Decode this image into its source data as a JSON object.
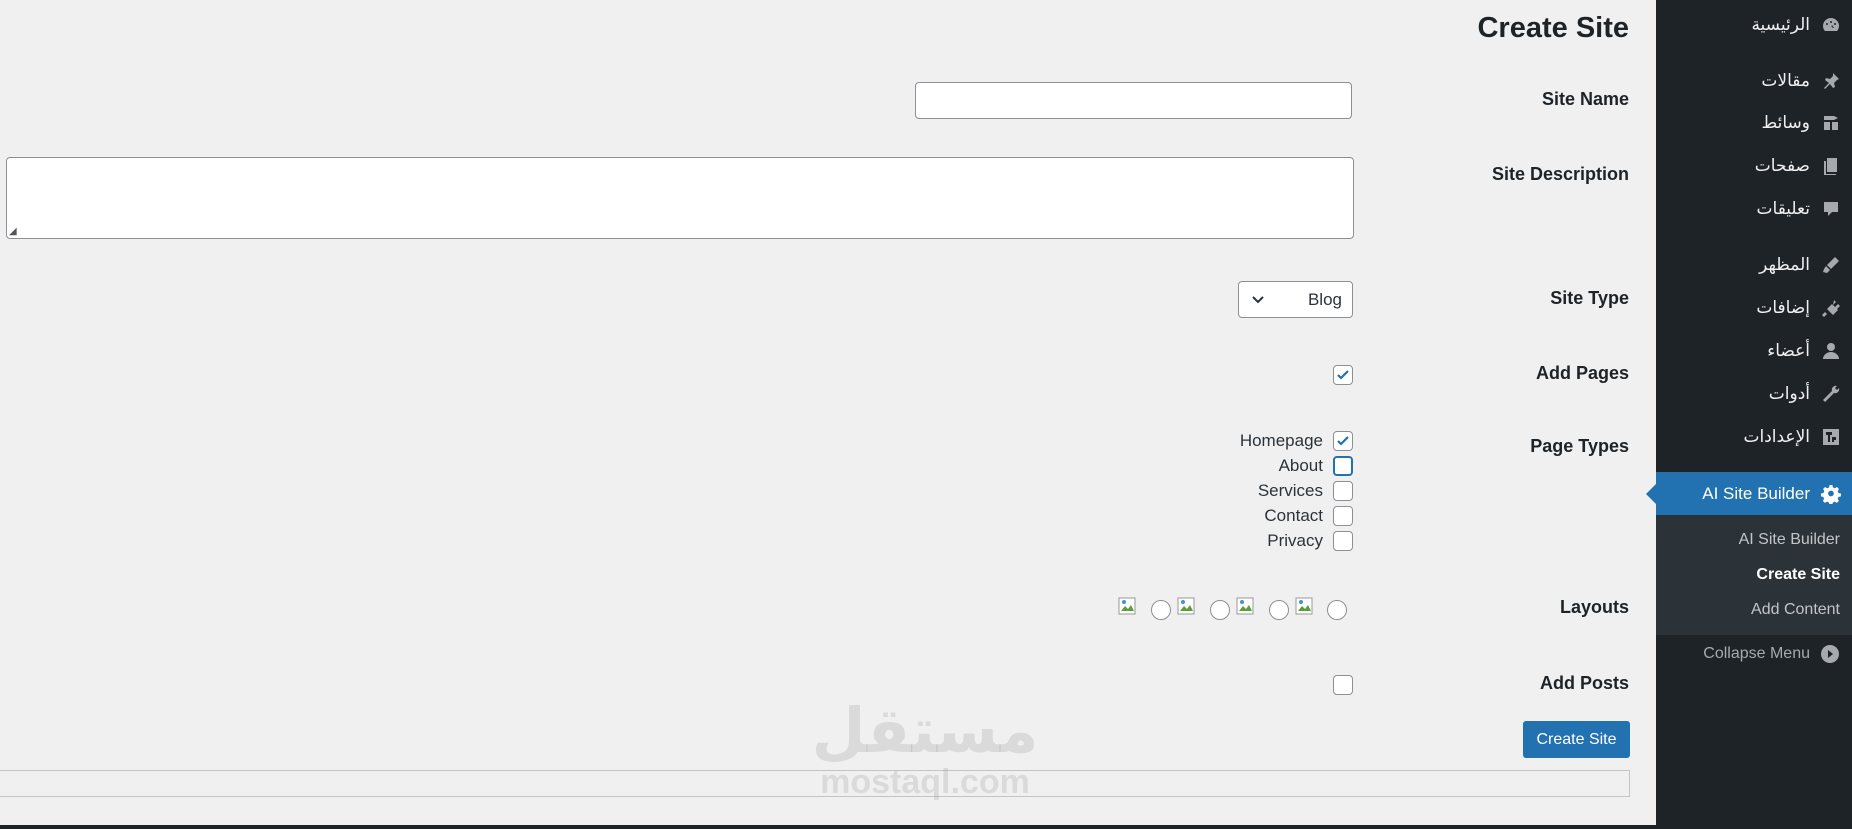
{
  "sidebar": {
    "items": [
      {
        "label": "الرئيسية",
        "icon": "dashboard-icon"
      },
      {
        "label": "مقالات",
        "icon": "pin-icon"
      },
      {
        "label": "وسائط",
        "icon": "media-icon"
      },
      {
        "label": "صفحات",
        "icon": "pages-icon"
      },
      {
        "label": "تعليقات",
        "icon": "comments-icon"
      },
      {
        "label": "المظهر",
        "icon": "appearance-icon"
      },
      {
        "label": "إضافات",
        "icon": "plugins-icon"
      },
      {
        "label": "أعضاء",
        "icon": "users-icon"
      },
      {
        "label": "أدوات",
        "icon": "tools-icon"
      },
      {
        "label": "الإعدادات",
        "icon": "settings-icon"
      }
    ],
    "active": {
      "label": "AI Site Builder",
      "icon": "gear-icon"
    },
    "submenu": [
      "AI Site Builder",
      "Create Site",
      "Add Content"
    ],
    "submenu_current": "Create Site",
    "collapse_label": "Collapse Menu",
    "accent_color": "#2271b1",
    "bg_color": "#1d2327"
  },
  "main": {
    "title": "Create Site",
    "labels": {
      "site_name": "Site Name",
      "site_description": "Site Description",
      "site_type": "Site Type",
      "add_pages": "Add Pages",
      "page_types": "Page Types",
      "layouts": "Layouts",
      "add_posts": "Add Posts"
    },
    "site_name_value": "",
    "site_description_value": "",
    "site_type_selected": "Blog",
    "add_pages_checked": true,
    "page_types": [
      {
        "label": "Homepage",
        "checked": true
      },
      {
        "label": "About",
        "checked": false
      },
      {
        "label": "Services",
        "checked": false
      },
      {
        "label": "Contact",
        "checked": false
      },
      {
        "label": "Privacy",
        "checked": false
      }
    ],
    "add_posts_checked": false,
    "submit_label": "Create Site"
  },
  "watermark": {
    "arabic": "مستقل",
    "latin": "mostaql.com"
  }
}
